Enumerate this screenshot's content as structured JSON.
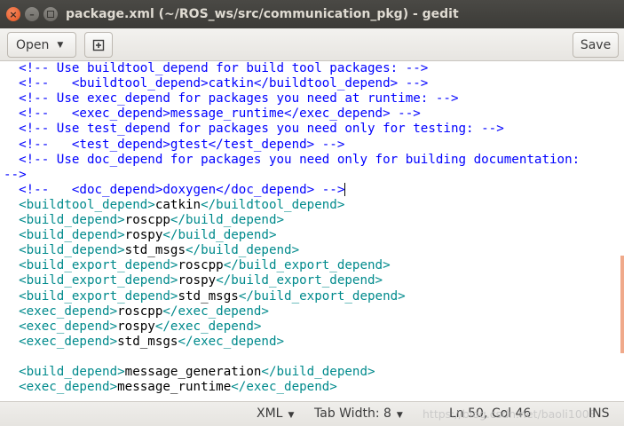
{
  "window": {
    "title": "package.xml (~/ROS_ws/src/communication_pkg) - gedit",
    "controls": {
      "close": "×",
      "minimize": "–"
    }
  },
  "toolbar": {
    "open_label": "Open",
    "open_arrow": "▼",
    "new_document_icon": "new-document-icon",
    "save_label": "Save"
  },
  "editor": {
    "colors": {
      "comment": "#0000ff",
      "tag": "#008a8c",
      "text": "#000000"
    },
    "lines": [
      [
        {
          "k": "c",
          "t": "  <!-- Use buildtool_depend for build tool packages: -->"
        }
      ],
      [
        {
          "k": "c",
          "t": "  <!--   <buildtool_depend>catkin</buildtool_depend> -->"
        }
      ],
      [
        {
          "k": "c",
          "t": "  <!-- Use exec_depend for packages you need at runtime: -->"
        }
      ],
      [
        {
          "k": "c",
          "t": "  <!--   <exec_depend>message_runtime</exec_depend> -->"
        }
      ],
      [
        {
          "k": "c",
          "t": "  <!-- Use test_depend for packages you need only for testing: -->"
        }
      ],
      [
        {
          "k": "c",
          "t": "  <!--   <test_depend>gtest</test_depend> -->"
        }
      ],
      [
        {
          "k": "c",
          "t": "  <!-- Use doc_depend for packages you need only for building documentation:"
        }
      ],
      [
        {
          "k": "c",
          "t": "-->"
        }
      ],
      [
        {
          "k": "c",
          "t": "  <!--   <doc_depend>doxygen</doc_depend> -->"
        },
        {
          "k": "cursor"
        }
      ],
      [
        {
          "k": "t",
          "t": "  <buildtool_depend>"
        },
        {
          "k": "x",
          "t": "catkin"
        },
        {
          "k": "t",
          "t": "</buildtool_depend>"
        }
      ],
      [
        {
          "k": "t",
          "t": "  <build_depend>"
        },
        {
          "k": "x",
          "t": "roscpp"
        },
        {
          "k": "t",
          "t": "</build_depend>"
        }
      ],
      [
        {
          "k": "t",
          "t": "  <build_depend>"
        },
        {
          "k": "x",
          "t": "rospy"
        },
        {
          "k": "t",
          "t": "</build_depend>"
        }
      ],
      [
        {
          "k": "t",
          "t": "  <build_depend>"
        },
        {
          "k": "x",
          "t": "std_msgs"
        },
        {
          "k": "t",
          "t": "</build_depend>"
        }
      ],
      [
        {
          "k": "t",
          "t": "  <build_export_depend>"
        },
        {
          "k": "x",
          "t": "roscpp"
        },
        {
          "k": "t",
          "t": "</build_export_depend>"
        }
      ],
      [
        {
          "k": "t",
          "t": "  <build_export_depend>"
        },
        {
          "k": "x",
          "t": "rospy"
        },
        {
          "k": "t",
          "t": "</build_export_depend>"
        }
      ],
      [
        {
          "k": "t",
          "t": "  <build_export_depend>"
        },
        {
          "k": "x",
          "t": "std_msgs"
        },
        {
          "k": "t",
          "t": "</build_export_depend>"
        }
      ],
      [
        {
          "k": "t",
          "t": "  <exec_depend>"
        },
        {
          "k": "x",
          "t": "roscpp"
        },
        {
          "k": "t",
          "t": "</exec_depend>"
        }
      ],
      [
        {
          "k": "t",
          "t": "  <exec_depend>"
        },
        {
          "k": "x",
          "t": "rospy"
        },
        {
          "k": "t",
          "t": "</exec_depend>"
        }
      ],
      [
        {
          "k": "t",
          "t": "  <exec_depend>"
        },
        {
          "k": "x",
          "t": "std_msgs"
        },
        {
          "k": "t",
          "t": "</exec_depend>"
        }
      ],
      [],
      [
        {
          "k": "t",
          "t": "  <build_depend>"
        },
        {
          "k": "x",
          "t": "message_generation"
        },
        {
          "k": "t",
          "t": "</build_depend>"
        }
      ],
      [
        {
          "k": "t",
          "t": "  <exec_depend>"
        },
        {
          "k": "x",
          "t": "message_runtime"
        },
        {
          "k": "t",
          "t": "</exec_depend>"
        }
      ]
    ]
  },
  "statusbar": {
    "language": "XML",
    "tab_width": "Tab Width: 8",
    "position": "Ln 50, Col 46",
    "mode": "INS",
    "watermark": "https://blog.csdn.net/baoli1008"
  },
  "accent_color": "#e2531f"
}
